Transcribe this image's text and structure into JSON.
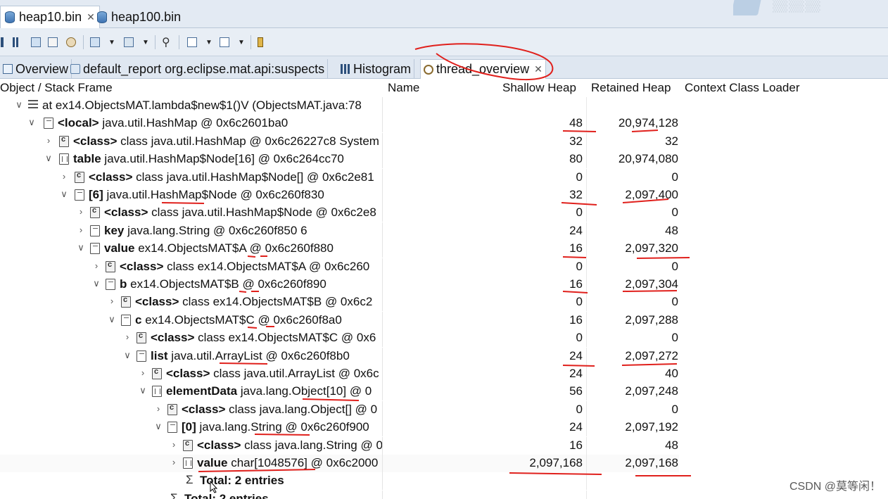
{
  "editor_tabs": [
    {
      "label": "heap10.bin",
      "active": true
    },
    {
      "label": "heap100.bin",
      "active": false
    }
  ],
  "view_tabs": [
    {
      "label": "Overview"
    },
    {
      "label": "default_report  org.eclipse.mat.api:suspects"
    },
    {
      "label": "Histogram"
    },
    {
      "label": "thread_overview",
      "active": true
    }
  ],
  "columns": {
    "object": "Object / Stack Frame",
    "name": "Name",
    "shallow": "Shallow Heap",
    "retained": "Retained Heap",
    "loader": "Context Class Loader"
  },
  "rows": [
    {
      "bold": "",
      "text": "at ex14.ObjectsMAT.lambda$new$1()V (ObjectsMAT.java:78",
      "shallow": "",
      "retained": "",
      "icon": "frame",
      "tw": "∨"
    },
    {
      "bold": "<local>",
      "text": " java.util.HashMap @ 0x6c2601ba0",
      "shallow": "48",
      "retained": "20,974,128",
      "icon": "local",
      "tw": "∨"
    },
    {
      "bold": "<class>",
      "text": " class java.util.HashMap @ 0x6c26227c8  System",
      "shallow": "32",
      "retained": "32",
      "icon": "cls",
      "tw": "›"
    },
    {
      "bold": "table",
      "text": " java.util.HashMap$Node[16] @ 0x6c264cc70",
      "shallow": "80",
      "retained": "20,974,080",
      "icon": "tbl",
      "tw": "∨"
    },
    {
      "bold": "<class>",
      "text": " class java.util.HashMap$Node[] @ 0x6c2e81",
      "shallow": "0",
      "retained": "0",
      "icon": "cls",
      "tw": "›"
    },
    {
      "bold": "[6]",
      "text": " java.util.HashMap$Node @ 0x6c260f830",
      "shallow": "32",
      "retained": "2,097,400",
      "icon": "local",
      "tw": "∨"
    },
    {
      "bold": "<class>",
      "text": " class java.util.HashMap$Node @ 0x6c2e8",
      "shallow": "0",
      "retained": "0",
      "icon": "cls",
      "tw": "›"
    },
    {
      "bold": "key",
      "text": " java.lang.String @ 0x6c260f850  6",
      "shallow": "24",
      "retained": "48",
      "icon": "local",
      "tw": "›"
    },
    {
      "bold": "value",
      "text": " ex14.ObjectsMAT$A @ 0x6c260f880",
      "shallow": "16",
      "retained": "2,097,320",
      "icon": "local",
      "tw": "∨"
    },
    {
      "bold": "<class>",
      "text": " class ex14.ObjectsMAT$A @ 0x6c260",
      "shallow": "0",
      "retained": "0",
      "icon": "cls",
      "tw": "›"
    },
    {
      "bold": "b",
      "text": " ex14.ObjectsMAT$B @ 0x6c260f890",
      "shallow": "16",
      "retained": "2,097,304",
      "icon": "local",
      "tw": "∨"
    },
    {
      "bold": "<class>",
      "text": " class ex14.ObjectsMAT$B @ 0x6c2",
      "shallow": "0",
      "retained": "0",
      "icon": "cls",
      "tw": "›"
    },
    {
      "bold": "c",
      "text": " ex14.ObjectsMAT$C @ 0x6c260f8a0",
      "shallow": "16",
      "retained": "2,097,288",
      "icon": "local",
      "tw": "∨"
    },
    {
      "bold": "<class>",
      "text": " class ex14.ObjectsMAT$C @ 0x6",
      "shallow": "0",
      "retained": "0",
      "icon": "cls",
      "tw": "›"
    },
    {
      "bold": "list",
      "text": " java.util.ArrayList @ 0x6c260f8b0",
      "shallow": "24",
      "retained": "2,097,272",
      "icon": "local",
      "tw": "∨"
    },
    {
      "bold": "<class>",
      "text": " class java.util.ArrayList @ 0x6c",
      "shallow": "24",
      "retained": "40",
      "icon": "cls",
      "tw": "›"
    },
    {
      "bold": "elementData",
      "text": " java.lang.Object[10] @ 0",
      "shallow": "56",
      "retained": "2,097,248",
      "icon": "tbl",
      "tw": "∨"
    },
    {
      "bold": "<class>",
      "text": " class java.lang.Object[] @ 0",
      "shallow": "0",
      "retained": "0",
      "icon": "cls",
      "tw": "›"
    },
    {
      "bold": "[0]",
      "text": " java.lang.String @ 0x6c260f900",
      "shallow": "24",
      "retained": "2,097,192",
      "icon": "local",
      "tw": "∨"
    },
    {
      "bold": "<class>",
      "text": " class java.lang.String @ 0",
      "shallow": "16",
      "retained": "48",
      "icon": "cls",
      "tw": "›"
    },
    {
      "bold": "value",
      "text": " char[1048576] @ 0x6c2000",
      "shallow": "2,097,168",
      "retained": "2,097,168",
      "icon": "tbl",
      "tw": "›"
    },
    {
      "bold": "Total: 2 entries",
      "text": "",
      "shallow": "",
      "retained": "",
      "icon": "sigma",
      "tw": ""
    },
    {
      "bold": "Total: 2 entries",
      "text": "",
      "shallow": "",
      "retained": "",
      "icon": "sigma",
      "tw": ""
    }
  ],
  "watermark": "CSDN @莫等闲！"
}
